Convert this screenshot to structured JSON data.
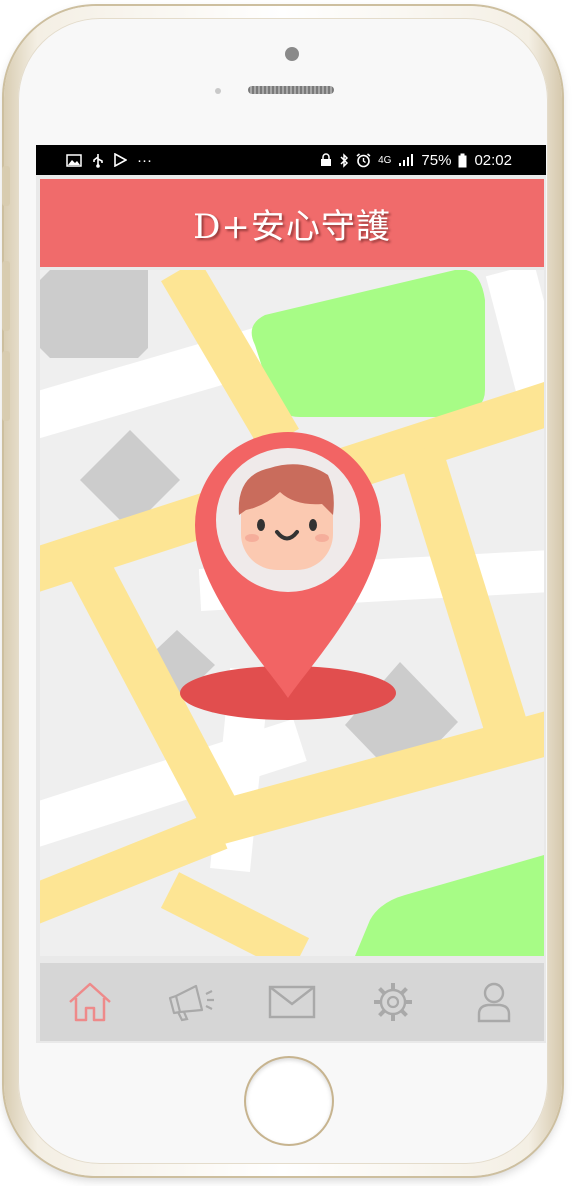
{
  "status_bar": {
    "more_indicator": "···",
    "network": "4G",
    "battery_percent": "75%",
    "time": "02:02"
  },
  "header": {
    "title": "D+安心守護"
  },
  "nav": {
    "items": [
      {
        "id": "home",
        "icon": "home-icon",
        "active": true
      },
      {
        "id": "announcements",
        "icon": "megaphone-icon",
        "active": false
      },
      {
        "id": "messages",
        "icon": "envelope-icon",
        "active": false
      },
      {
        "id": "settings",
        "icon": "gear-icon",
        "active": false
      },
      {
        "id": "profile",
        "icon": "user-icon",
        "active": false
      }
    ]
  },
  "colors": {
    "brand": "#f06b6b",
    "pin": "#f26464",
    "pin_shadow": "#e14e4e",
    "road": "#fde594",
    "park": "#a7fc86",
    "building": "#cccccc",
    "nav_active": "#ee8a8a",
    "nav_inactive": "#a9a9a9"
  }
}
